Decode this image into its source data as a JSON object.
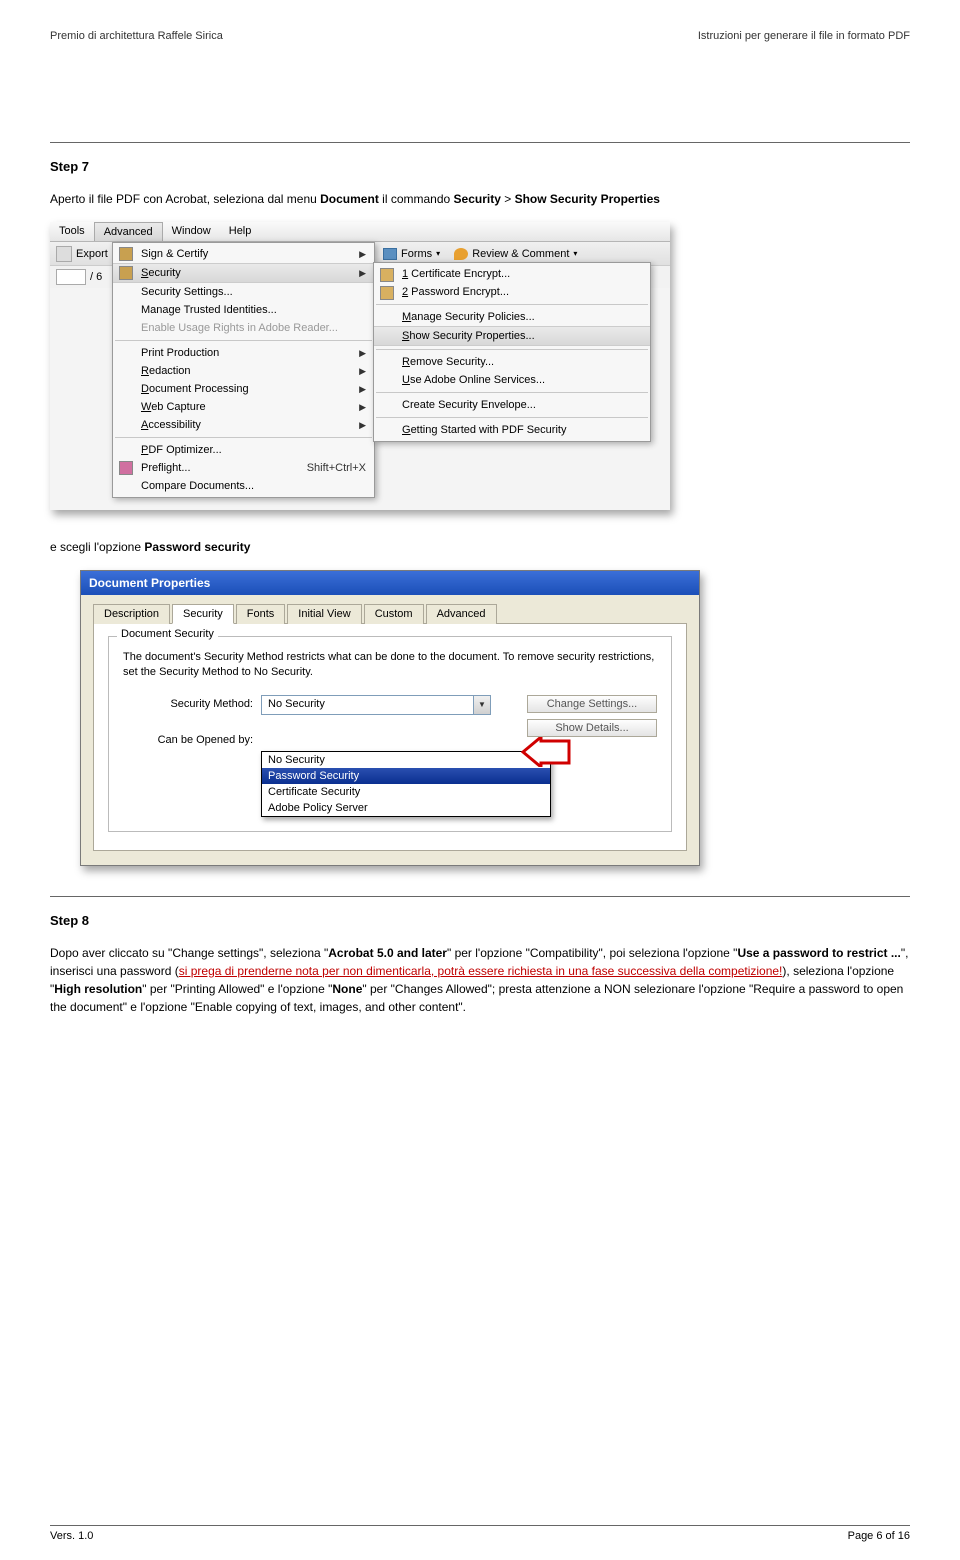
{
  "header": {
    "left": "Premio di architettura Raffele Sirica",
    "right": "Istruzioni per generare il file in formato PDF"
  },
  "step7": {
    "title": "Step 7",
    "intro_1": "Aperto il file PDF con Acrobat, seleziona dal menu ",
    "intro_b1": "Document",
    "intro_2": " il commando ",
    "intro_b2": "Security",
    "intro_3": " > ",
    "intro_b3": "Show Security Properties",
    "after": " e scegli l'opzione ",
    "after_b": "Password security"
  },
  "shot1": {
    "menubar": [
      "Tools",
      "Advanced",
      "Window",
      "Help"
    ],
    "menubar_active_index": 1,
    "toolbar_export": "Export",
    "pager_text": "/ 6",
    "right_forms": "Forms",
    "right_review": "Review & Comment",
    "menu": [
      {
        "label": "Sign & Certify",
        "icon": "sign-icon",
        "arrow": true
      },
      {
        "label": "Security",
        "icon": "security-icon",
        "arrow": true,
        "highlight": true
      },
      {
        "label": "Security Settings...",
        "icon": ""
      },
      {
        "label": "Manage Trusted Identities...",
        "icon": ""
      },
      {
        "label": "Enable Usage Rights in Adobe Reader...",
        "icon": "",
        "disabled": true
      },
      {
        "sep": true
      },
      {
        "label": "Print Production",
        "icon": "",
        "arrow": true
      },
      {
        "label": "Redaction",
        "icon": "",
        "arrow": true
      },
      {
        "label": "Document Processing",
        "icon": "",
        "arrow": true
      },
      {
        "label": "Web Capture",
        "icon": "",
        "arrow": true
      },
      {
        "label": "Accessibility",
        "icon": "",
        "arrow": true
      },
      {
        "sep": true
      },
      {
        "label": "PDF Optimizer...",
        "icon": ""
      },
      {
        "label": "Preflight...",
        "icon": "preflight-icon",
        "shortcut": "Shift+Ctrl+X"
      },
      {
        "label": "Compare Documents...",
        "icon": ""
      }
    ],
    "submenu": [
      {
        "label": "1 Certificate Encrypt...",
        "icon": "cert-icon"
      },
      {
        "label": "2 Password Encrypt...",
        "icon": "pwd-icon"
      },
      {
        "sep": true
      },
      {
        "label": "Manage Security Policies..."
      },
      {
        "label": "Show Security Properties...",
        "highlight": true
      },
      {
        "sep": true
      },
      {
        "label": "Remove Security..."
      },
      {
        "label": "Use Adobe Online Services..."
      },
      {
        "sep": true
      },
      {
        "label": "Create Security Envelope..."
      },
      {
        "sep": true
      },
      {
        "label": "Getting Started with PDF Security"
      }
    ]
  },
  "shot2": {
    "titlebar": "Document Properties",
    "tabs": [
      "Description",
      "Security",
      "Fonts",
      "Initial View",
      "Custom",
      "Advanced"
    ],
    "tabs_active_index": 1,
    "fieldset_legend": "Document Security",
    "desc": "The document's Security Method restricts what can be done to the document. To remove security restrictions, set the Security Method to No Security.",
    "row1_label": "Security Method:",
    "row1_value": "No Security",
    "btn1": "Change Settings...",
    "row2_label": "Can be Opened by:",
    "btn2": "Show Details...",
    "options": [
      "No Security",
      "Password Security",
      "Certificate Security",
      "Adobe Policy Server"
    ],
    "options_selected_index": 1
  },
  "step8": {
    "title": "Step 8",
    "p1": "Dopo aver cliccato su \"Change settings\", seleziona \"",
    "b1": "Acrobat 5.0 and later",
    "p2": "\" per l'opzione \"Compatibility\", poi seleziona l'opzione \"",
    "b2": "Use a password to restrict ...",
    "p3": "\", inserisci una password (",
    "red": "si prega di prenderne nota per non dimenticarla, potrà essere richiesta in una fase successiva della competizione!",
    "p4": "), seleziona l'opzione \"",
    "b3": "High resolution",
    "p5": "\" per \"Printing Allowed\" e l'opzione \"",
    "b4": "None",
    "p6": "\" per \"Changes Allowed\"; presta attenzione a NON selezionare l'opzione \"Require a password to open the document\"  e l'opzione \"Enable copying of text, images, and other content\"."
  },
  "footer": {
    "left": "Vers. 1.0",
    "right": "Page 6 of 16"
  }
}
